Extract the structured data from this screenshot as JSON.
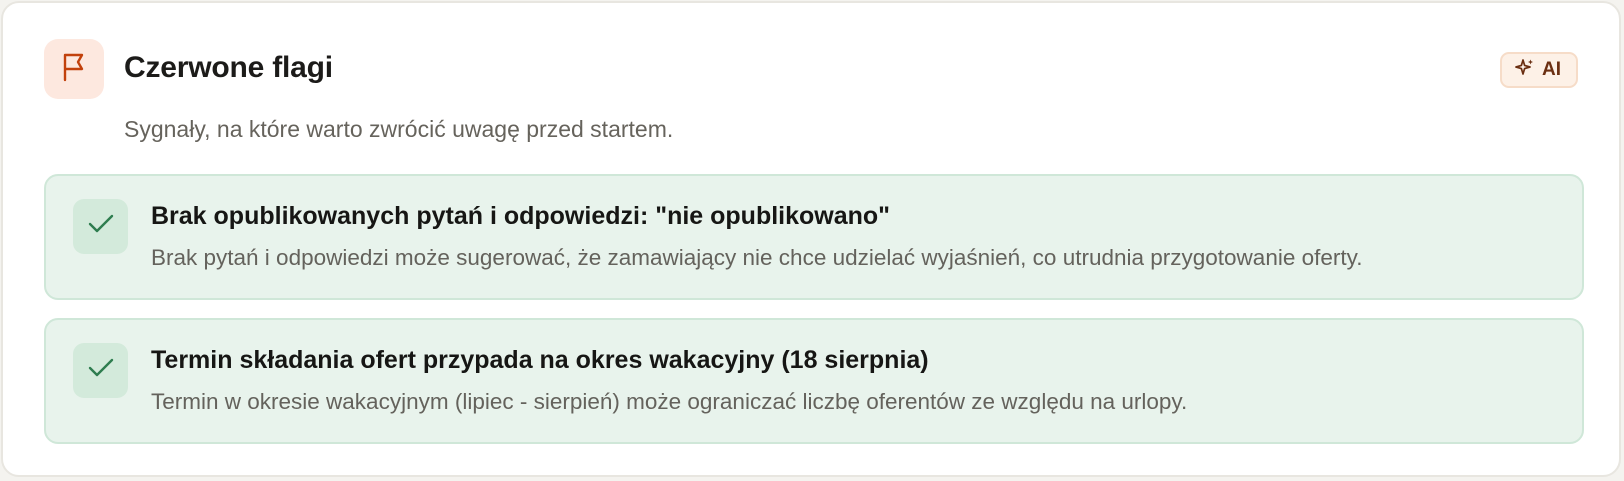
{
  "header": {
    "icon": "flag-icon",
    "title": "Czerwone flagi",
    "subtitle": "Sygnały, na które warto zwrócić uwagę przed startem.",
    "badge": {
      "icon": "sparkles-icon",
      "label": "AI"
    }
  },
  "flags": [
    {
      "icon": "check-icon",
      "title": "Brak opublikowanych pytań i odpowiedzi: \"nie opublikowano\"",
      "description": "Brak pytań i odpowiedzi może sugerować, że zamawiający nie chce udzielać wyjaśnień, co utrudnia przygotowanie oferty."
    },
    {
      "icon": "check-icon",
      "title": "Termin składania ofert przypada na okres wakacyjny (18 sierpnia)",
      "description": "Termin w okresie wakacyjnym (lipiec - sierpień) może ograniczać liczbę oferentów ze względu na urlopy."
    }
  ],
  "colors": {
    "accent_orange": "#c2410c",
    "flag_bg": "#fde8df",
    "item_bg": "#e8f3ec",
    "item_border": "#cfe7d8",
    "check_green": "#2e7d4f"
  }
}
